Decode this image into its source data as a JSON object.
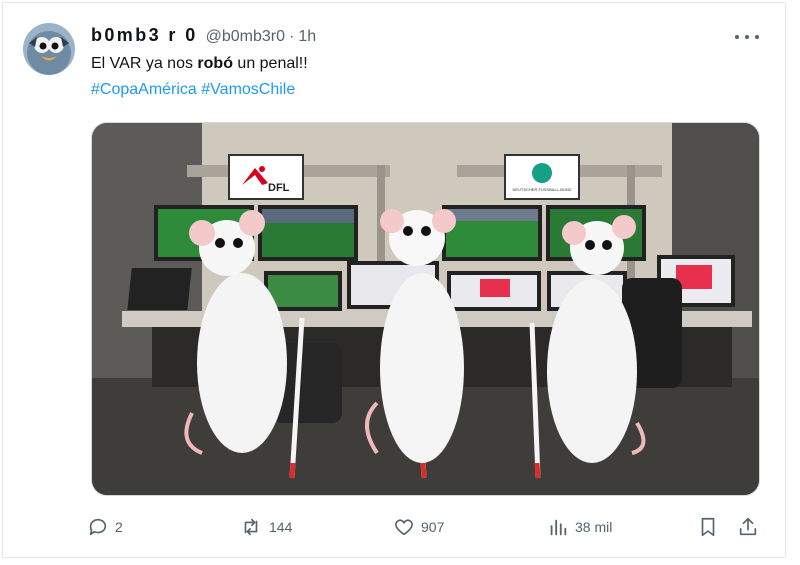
{
  "tweet": {
    "display_name": "b0mb3 r 0",
    "handle": "@b0mb3r0",
    "separator": "·",
    "time": "1h",
    "text_before": "El VAR ya nos ",
    "text_bold": "robó",
    "text_after": " un penal!!",
    "hashtags": [
      "#CopaAmérica",
      "#VamosChile"
    ]
  },
  "media": {
    "logo_left": "DFL",
    "logo_right_caption": "DEUTSCHER FUSSBALL-BUND"
  },
  "actions": {
    "replies": "2",
    "reposts": "144",
    "likes": "907",
    "views": "38 mil"
  },
  "icons": {
    "more": "more-icon",
    "reply": "reply-icon",
    "repost": "repost-icon",
    "like": "like-icon",
    "views": "views-icon",
    "bookmark": "bookmark-icon",
    "share": "share-icon"
  },
  "colors": {
    "link": "#1d9bf0",
    "muted": "#536471",
    "text": "#0f1419"
  }
}
